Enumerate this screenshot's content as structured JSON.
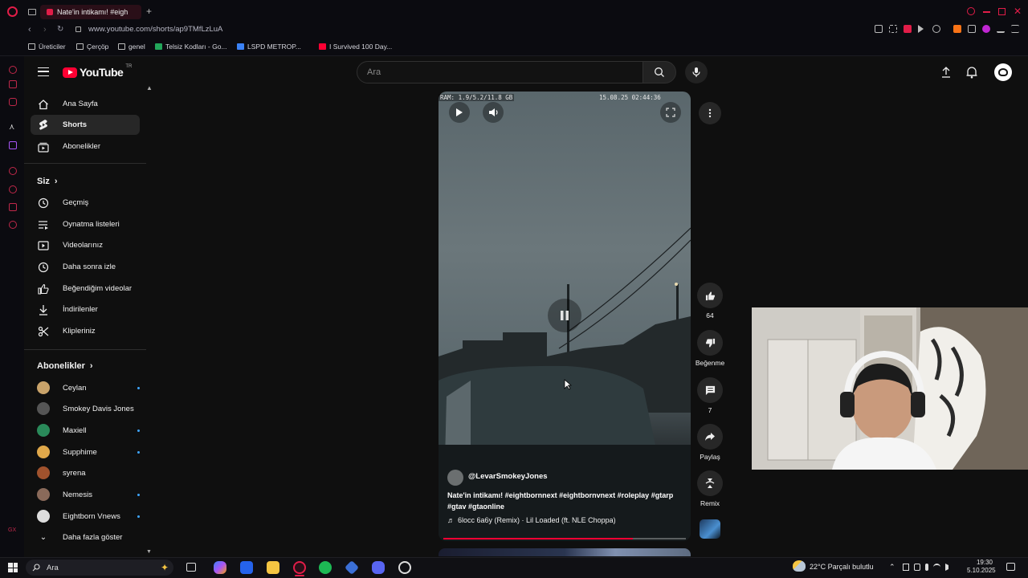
{
  "browser": {
    "tab_title": "Nate'in intikamı! #eigh",
    "url": "www.youtube.com/shorts/ap9TMfLzLuA",
    "bookmarks": [
      "Üreticiler",
      "Çerçöp",
      "genel",
      "Telsiz Kodları - Go...",
      "LSPD METROP...",
      "I Survived 100 Day..."
    ]
  },
  "header": {
    "logo_text": "YouTube",
    "logo_region": "TR",
    "search_placeholder": "Ara"
  },
  "sidebar": {
    "main": [
      {
        "label": "Ana Sayfa",
        "icon": "home-icon"
      },
      {
        "label": "Shorts",
        "icon": "shorts-icon",
        "active": true
      },
      {
        "label": "Abonelikler",
        "icon": "subscriptions-icon"
      }
    ],
    "you_heading": "Siz",
    "you_items": [
      {
        "label": "Geçmiş",
        "icon": "history-icon"
      },
      {
        "label": "Oynatma listeleri",
        "icon": "playlist-icon"
      },
      {
        "label": "Videolarınız",
        "icon": "your-videos-icon"
      },
      {
        "label": "Daha sonra izle",
        "icon": "watch-later-icon"
      },
      {
        "label": "Beğendiğim videolar",
        "icon": "liked-icon"
      },
      {
        "label": "İndirilenler",
        "icon": "download-icon"
      },
      {
        "label": "Klipleriniz",
        "icon": "clips-icon"
      }
    ],
    "subs_heading": "Abonelikler",
    "subscriptions": [
      {
        "name": "Ceylan",
        "color": "#c9a36a",
        "live": true
      },
      {
        "name": "Smokey Davis Jones",
        "color": "#555555",
        "live": false
      },
      {
        "name": "Maxiell",
        "color": "#2a8a5a",
        "live": true
      },
      {
        "name": "Supphime",
        "color": "#e0a84a",
        "live": true
      },
      {
        "name": "syrena",
        "color": "#a0522d",
        "live": false
      },
      {
        "name": "Nemesis",
        "color": "#8a6a5a",
        "live": true
      },
      {
        "name": "Eightborn Vnews",
        "color": "#dddddd",
        "live": true
      }
    ],
    "show_more": "Daha fazla göster"
  },
  "video": {
    "overlay_ram": "RAM: 1.9/5.2/11.8 GB",
    "overlay_time": "15.08.25 02:44:36",
    "channel": "@LevarSmokeyJones",
    "caption": "Nate'in intikamı!  #eightbornnext #eightbornvnext #roleplay #gtarp #gtav #gtaonline",
    "music": "6locc 6a6y (Remix) · Lil Loaded (ft. NLE Choppa)",
    "progress": 0.78
  },
  "actions": {
    "likes": "64",
    "dislike_label": "Beğenme",
    "comments": "7",
    "share_label": "Paylaş",
    "remix_label": "Remix"
  },
  "taskbar": {
    "search_placeholder": "Ara",
    "weather": "22°C  Parçalı bulutlu",
    "time": "19:30",
    "date": "5.10.2025"
  },
  "colors": {
    "accent": "#ff0033",
    "opera_red": "#e11d48",
    "live_dot": "#3ea6ff"
  }
}
